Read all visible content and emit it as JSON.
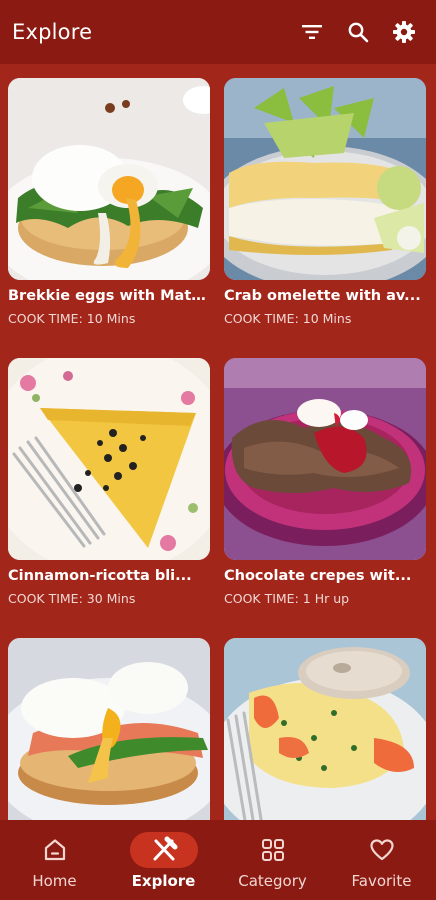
{
  "app": {
    "title": "Explore"
  },
  "appbar_actions": [
    {
      "icon": "filter-icon"
    },
    {
      "icon": "search-icon"
    },
    {
      "icon": "settings-gear-icon"
    }
  ],
  "recipes": [
    {
      "name": "Brekkie eggs with Matt...",
      "cook_time": "COOK TIME: 10 Mins"
    },
    {
      "name": "Crab omelette with av...",
      "cook_time": "COOK TIME: 10 Mins"
    },
    {
      "name": "Cinnamon-ricotta bli...",
      "cook_time": "COOK TIME: 30 Mins"
    },
    {
      "name": "Chocolate crepes wit...",
      "cook_time": "COOK TIME: 1 Hr up"
    },
    {
      "name": "",
      "cook_time": ""
    },
    {
      "name": "",
      "cook_time": ""
    }
  ],
  "bottom_nav": [
    {
      "label": "Home",
      "icon": "home-icon"
    },
    {
      "label": "Explore",
      "icon": "fork-knife-icon",
      "active": true
    },
    {
      "label": "Category",
      "icon": "grid-icon"
    },
    {
      "label": "Favorite",
      "icon": "heart-icon"
    }
  ],
  "colors": {
    "background": "#a3261b",
    "bar": "#8a1a12",
    "active_pill": "#c8331f"
  }
}
